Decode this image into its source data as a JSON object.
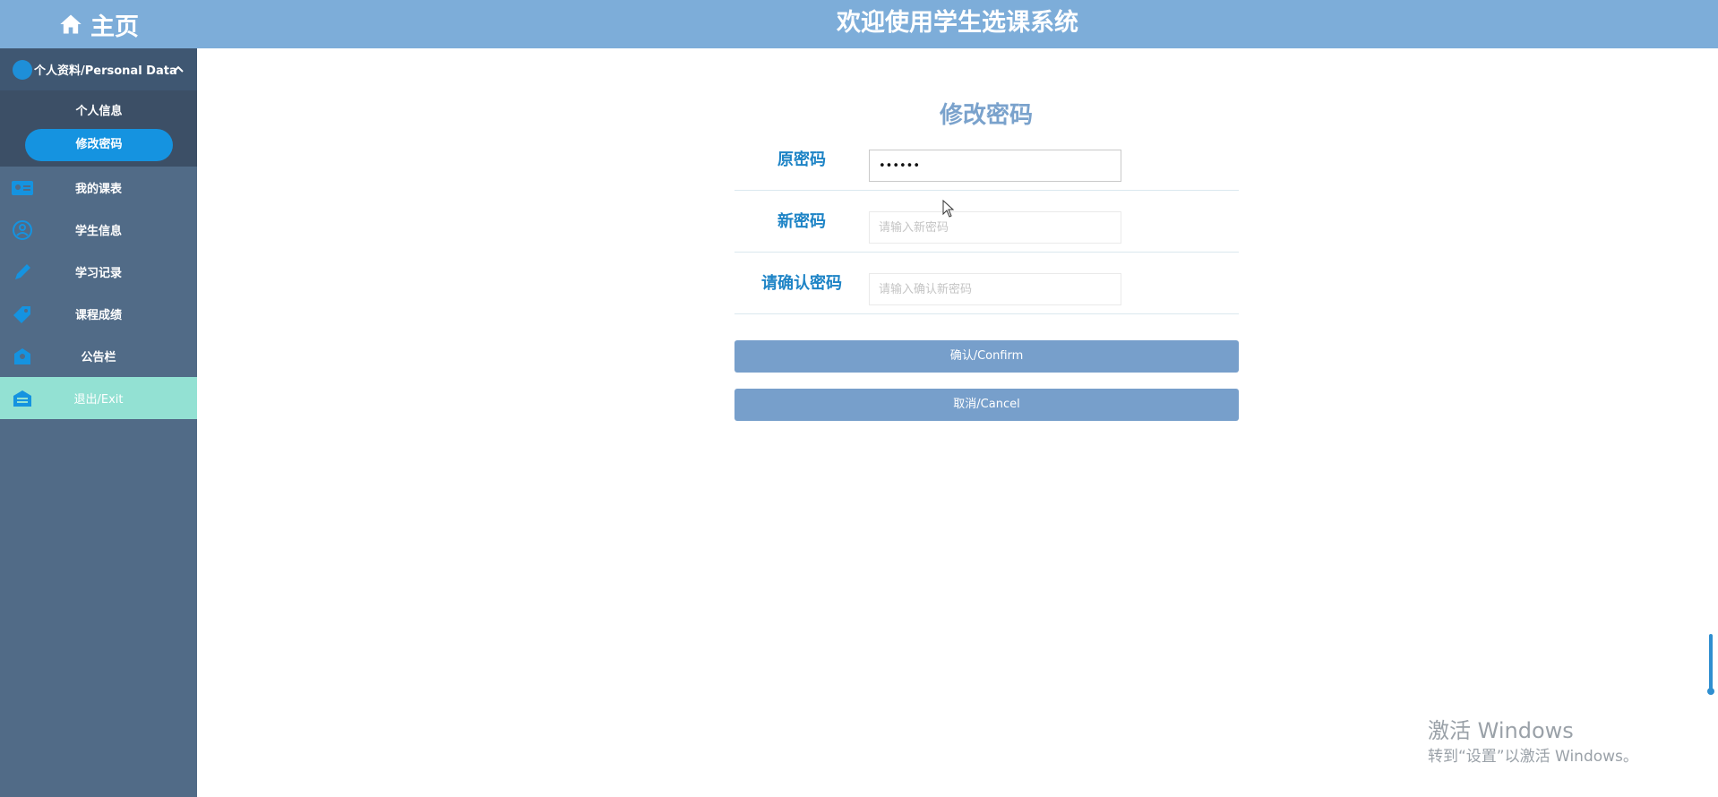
{
  "sidebar": {
    "brand": "主页",
    "group_header": "个人资料/Personal Data",
    "sub_items": [
      "个人信息",
      "修改密码"
    ],
    "nav_items": [
      "我的课表",
      "学生信息",
      "学习记录",
      "课程成绩",
      "公告栏",
      "退出/Exit"
    ]
  },
  "header": {
    "title": "欢迎使用学生选课系统"
  },
  "form": {
    "title": "修改密码",
    "old_password": {
      "label": "原密码",
      "value": "••••••",
      "placeholder": ""
    },
    "new_password": {
      "label": "新密码",
      "value": "",
      "placeholder": "请输入新密码"
    },
    "confirm_password": {
      "label": "请确认密码",
      "value": "",
      "placeholder": "请输入确认新密码"
    },
    "confirm_button": "确认/Confirm",
    "cancel_button": "取消/Cancel"
  },
  "watermark": {
    "line1": "激活 Windows",
    "line2": "转到“设置”以激活 Windows。"
  },
  "colors": {
    "header_bg": "#7dadd9",
    "sidebar_bg": "#516b87",
    "active_pill": "#1593e0",
    "exit_bg": "#93e1d3",
    "button_bg": "#779fcb",
    "label_color": "#1e84c6"
  }
}
